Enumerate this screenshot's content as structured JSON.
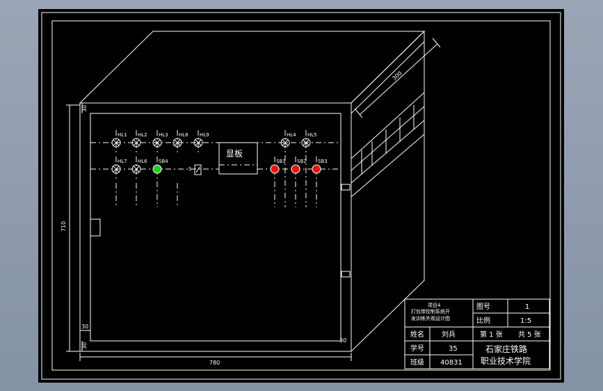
{
  "drawing": {
    "dimensions": {
      "depth": "300",
      "height": "710",
      "width": "780",
      "top_margin": "30",
      "bottom_margin_a": "30",
      "bottom_margin_b": "30",
      "right_margin": "30"
    },
    "panel_label": "显板",
    "lamps_row1": [
      "HL1",
      "HL2",
      "HL3",
      "HL8",
      "HL9",
      "HL4",
      "HL5"
    ],
    "lamps_row2": [
      "HL7",
      "HL6",
      "SB4",
      "SB1",
      "SB2",
      "SB3"
    ],
    "switch_label": "S",
    "colors": {
      "green_button": "#1fd21f",
      "red_button": "#e01818",
      "line": "#ffffff"
    }
  },
  "title_block": {
    "project_line1": "项目4",
    "project_line2": "打包带控制系统开",
    "project_line3": "发训练外观设计图",
    "drawing_no_label": "图号",
    "drawing_no_value": "1",
    "scale_label": "比例",
    "scale_value": "1:5",
    "name_label": "姓名",
    "name_value": "刘兵",
    "sheet_text": "第 1 张",
    "total_text": "共 5 张",
    "student_no_label": "学号",
    "student_no_value": "35",
    "class_label": "班级",
    "class_value": "40831",
    "school_line1": "石家庄铁路",
    "school_line2": "职业技术学院"
  }
}
